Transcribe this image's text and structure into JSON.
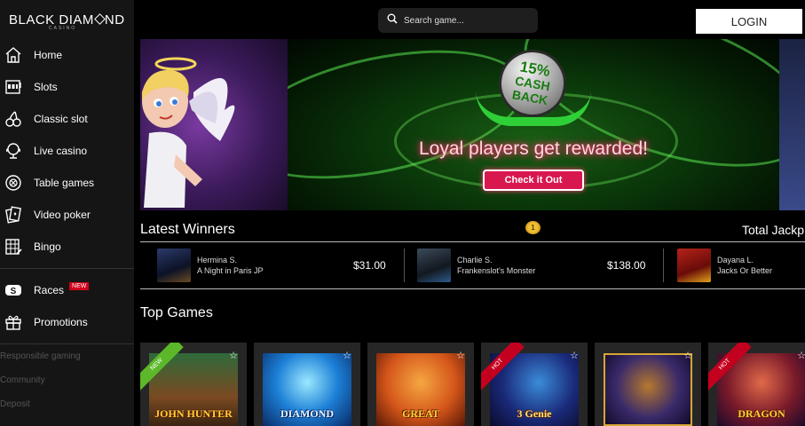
{
  "brand": {
    "name_part1": "BLACK",
    "name_part2": "DIAM",
    "name_part3": "ND",
    "subtitle": "CASINO"
  },
  "header": {
    "search_placeholder": "Search game...",
    "login_label": "LOGIN"
  },
  "sidebar": {
    "items": [
      {
        "label": "Home",
        "icon": "home-icon"
      },
      {
        "label": "Slots",
        "icon": "slots-icon"
      },
      {
        "label": "Classic slot",
        "icon": "cherries-icon"
      },
      {
        "label": "Live casino",
        "icon": "dealer-icon"
      },
      {
        "label": "Table games",
        "icon": "roulette-icon"
      },
      {
        "label": "Video poker",
        "icon": "cards-icon"
      },
      {
        "label": "Bingo",
        "icon": "bingo-icon"
      }
    ],
    "races": {
      "label": "Races",
      "badge": "NEW",
      "icon": "races-icon"
    },
    "promotions": {
      "label": "Promotions",
      "icon": "gift-icon"
    },
    "footer_links": [
      "Responsible gaming",
      "Community",
      "Deposit"
    ]
  },
  "banner": {
    "badge_percent": "15%",
    "badge_line1": "CASH",
    "badge_line2": "BACK",
    "headline": "Loyal players get rewarded!",
    "cta_label": "Check it Out"
  },
  "winners": {
    "title": "Latest Winners",
    "jackpot_title": "Total Jackp",
    "trophy_label": "1",
    "items": [
      {
        "name": "Hermina S.",
        "game": "A Night in Paris JP",
        "amount": "$31.00"
      },
      {
        "name": "Charlie S.",
        "game": "Frankenslot's Monster",
        "amount": "$138.00"
      },
      {
        "name": "Dayana L.",
        "game": "Jacks Or Better",
        "amount": ""
      }
    ]
  },
  "top_games": {
    "title": "Top Games",
    "games": [
      {
        "title": "JOHN HUNTER",
        "ribbon": "NEW"
      },
      {
        "title": "DIAMOND",
        "ribbon": ""
      },
      {
        "title": "GREAT",
        "ribbon": ""
      },
      {
        "title": "3 Genie",
        "ribbon": "HOT"
      },
      {
        "title": "",
        "ribbon": ""
      },
      {
        "title": "DRAGON",
        "ribbon": "HOT"
      }
    ]
  },
  "colors": {
    "accent": "#d9174f",
    "sidebar_bg": "#151515",
    "new_badge": "#d0021b",
    "hot_ribbon": "#c4001f",
    "new_ribbon": "#5cb82a"
  }
}
